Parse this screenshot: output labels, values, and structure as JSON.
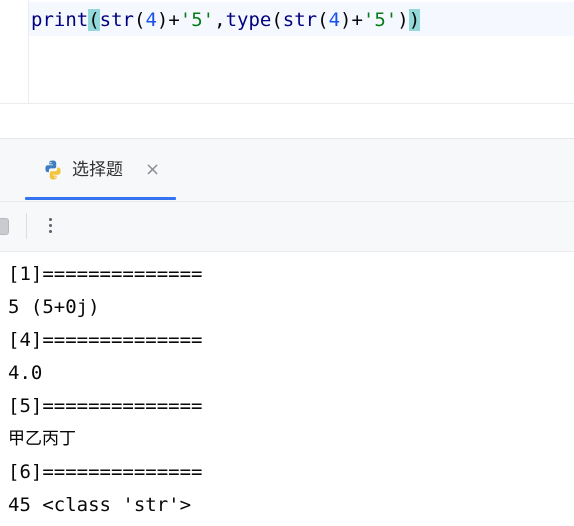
{
  "editor": {
    "code": {
      "t1": "print",
      "t2": "(",
      "t3": "str",
      "t4": "(",
      "t5": "4",
      "t6": ")+",
      "t7": "'5'",
      "t8": ",",
      "t9": "type",
      "t10": "(",
      "t11": "str",
      "t12": "(",
      "t13": "4",
      "t14": ")+",
      "t15": "'5'",
      "t16": ")",
      "t17": ")"
    }
  },
  "run_panel": {
    "tab_label": "选择题",
    "tab_close": "×",
    "tab_icon": "python-icon",
    "accent": "#3574f0"
  },
  "console": {
    "lines": [
      "[1]==============",
      "5 (5+0j)",
      "[4]==============",
      "4.0",
      "[5]==============",
      "甲乙丙丁",
      "[6]==============",
      "45 <class 'str'>"
    ]
  }
}
